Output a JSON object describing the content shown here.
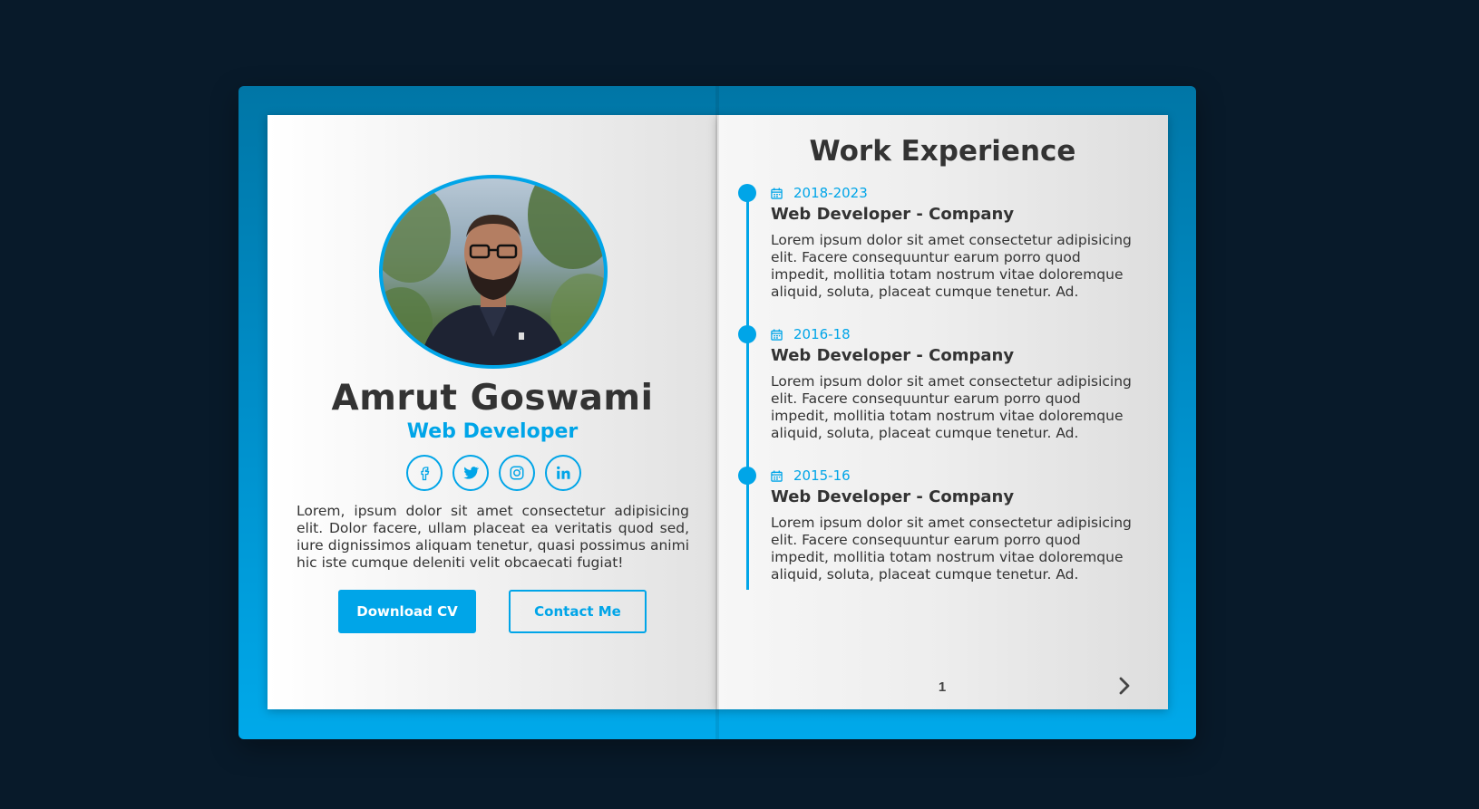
{
  "profile": {
    "name": "Amrut Goswami",
    "role": "Web Developer",
    "bio": "Lorem, ipsum dolor sit amet consectetur adipisicing elit. Dolor facere, ullam placeat ea veritatis quod sed, iure dignissimos aliquam tenetur, quasi possimus animi hic iste cumque deleniti velit obcaecati fugiat!",
    "socials": [
      {
        "icon": "facebook-icon",
        "glyph": "f"
      },
      {
        "icon": "twitter-icon",
        "glyph": ""
      },
      {
        "icon": "instagram-icon",
        "glyph": ""
      },
      {
        "icon": "linkedin-icon",
        "glyph": "in"
      }
    ],
    "buttons": {
      "download": "Download CV",
      "contact": "Contact Me"
    }
  },
  "experience": {
    "title": "Work Experience",
    "entries": [
      {
        "date": "2018-2023",
        "title": "Web Developer - Company",
        "desc": "Lorem ipsum dolor sit amet consectetur adipisicing elit. Facere consequuntur earum porro quod impedit, mollitia totam nostrum vitae doloremque aliquid, soluta, placeat cumque tenetur. Ad."
      },
      {
        "date": "2016-18",
        "title": "Web Developer - Company",
        "desc": "Lorem ipsum dolor sit amet consectetur adipisicing elit. Facere consequuntur earum porro quod impedit, mollitia totam nostrum vitae doloremque aliquid, soluta, placeat cumque tenetur. Ad."
      },
      {
        "date": "2015-16",
        "title": "Web Developer - Company",
        "desc": "Lorem ipsum dolor sit amet consectetur adipisicing elit. Facere consequuntur earum porro quod impedit, mollitia totam nostrum vitae doloremque aliquid, soluta, placeat cumque tenetur. Ad."
      }
    ],
    "page_number": "1"
  },
  "colors": {
    "accent": "#00a5e8",
    "background": "#081a2a",
    "text": "#333333"
  }
}
